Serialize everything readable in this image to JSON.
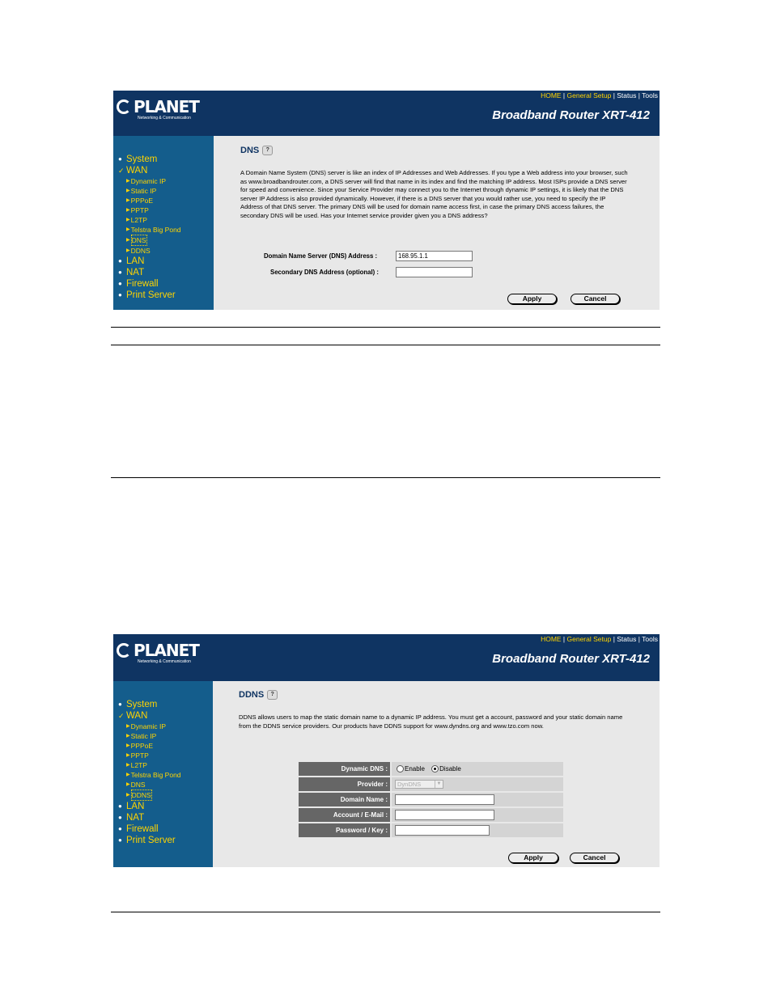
{
  "screen1": {
    "logo": {
      "word": "PLANET",
      "tagline": "Networking & Communication"
    },
    "top_links": [
      {
        "label": "HOME",
        "sep": " | "
      },
      {
        "label": "General Setup",
        "sep": " | "
      },
      {
        "label": "Status",
        "sep": " | "
      },
      {
        "label": "Tools",
        "sep": ""
      }
    ],
    "product": "Broadband Router XRT-412",
    "menu": {
      "system": "System",
      "wan": "WAN",
      "wan_sub": [
        "Dynamic IP",
        "Static IP",
        "PPPoE",
        "PPTP",
        "L2TP",
        "Telstra Big Pond",
        "DNS",
        "DDNS"
      ],
      "lan": "LAN",
      "nat": "NAT",
      "firewall": "Firewall",
      "print_server": "Print Server"
    },
    "title": "DNS",
    "description": "A Domain Name System (DNS) server is like an index of IP Addresses and Web Addresses. If you type a Web address into your browser, such as www.broadbandrouter.com, a DNS server will find that name in its index and find the matching IP address. Most ISPs provide a DNS server for speed and convenience. Since your Service Provider may connect you to the Internet through dynamic IP settings, it is likely that the DNS server IP Address is also provided dynamically. However, if there is a DNS server that you would rather use, you need to specify the IP Address of that DNS server. The primary DNS will be used for domain name access first, in case the primary DNS access failures, the secondary DNS will be used. Has your Internet service provider given you a DNS address?",
    "fields": {
      "dns_label": "Domain Name Server (DNS) Address :",
      "dns_value": "168.95.1.1",
      "secondary_label": "Secondary DNS Address (optional) :",
      "secondary_value": ""
    },
    "apply": "Apply",
    "cancel": "Cancel"
  },
  "screen2": {
    "logo": {
      "word": "PLANET",
      "tagline": "Networking & Communication"
    },
    "top_links": [
      {
        "label": "HOME",
        "sep": " | "
      },
      {
        "label": "General Setup",
        "sep": " | "
      },
      {
        "label": "Status",
        "sep": " | "
      },
      {
        "label": "Tools",
        "sep": ""
      }
    ],
    "product": "Broadband Router XRT-412",
    "menu": {
      "system": "System",
      "wan": "WAN",
      "wan_sub": [
        "Dynamic IP",
        "Static IP",
        "PPPoE",
        "PPTP",
        "L2TP",
        "Telstra Big Pond",
        "DNS",
        "DDNS"
      ],
      "lan": "LAN",
      "nat": "NAT",
      "firewall": "Firewall",
      "print_server": "Print Server"
    },
    "title": "DDNS",
    "description": "DDNS allows users to map the static domain name to a dynamic IP address. You must get a account, password and your static domain name from the DDNS service providers. Our products have DDNS support for www.dyndns.org and www.tzo.com now.",
    "table": {
      "dynamic_dns_label": "Dynamic DNS :",
      "enable": "Enable",
      "disable": "Disable",
      "provider_label": "Provider :",
      "provider_value": "DynDNS",
      "domain_label": "Domain Name :",
      "account_label": "Account / E-Mail :",
      "password_label": "Password / Key :"
    },
    "apply": "Apply",
    "cancel": "Cancel"
  },
  "colors": {
    "header": "#0f3462",
    "sidebar": "#145d8c",
    "menu_text": "#ffd400",
    "content_bg": "#e8e8e8"
  }
}
